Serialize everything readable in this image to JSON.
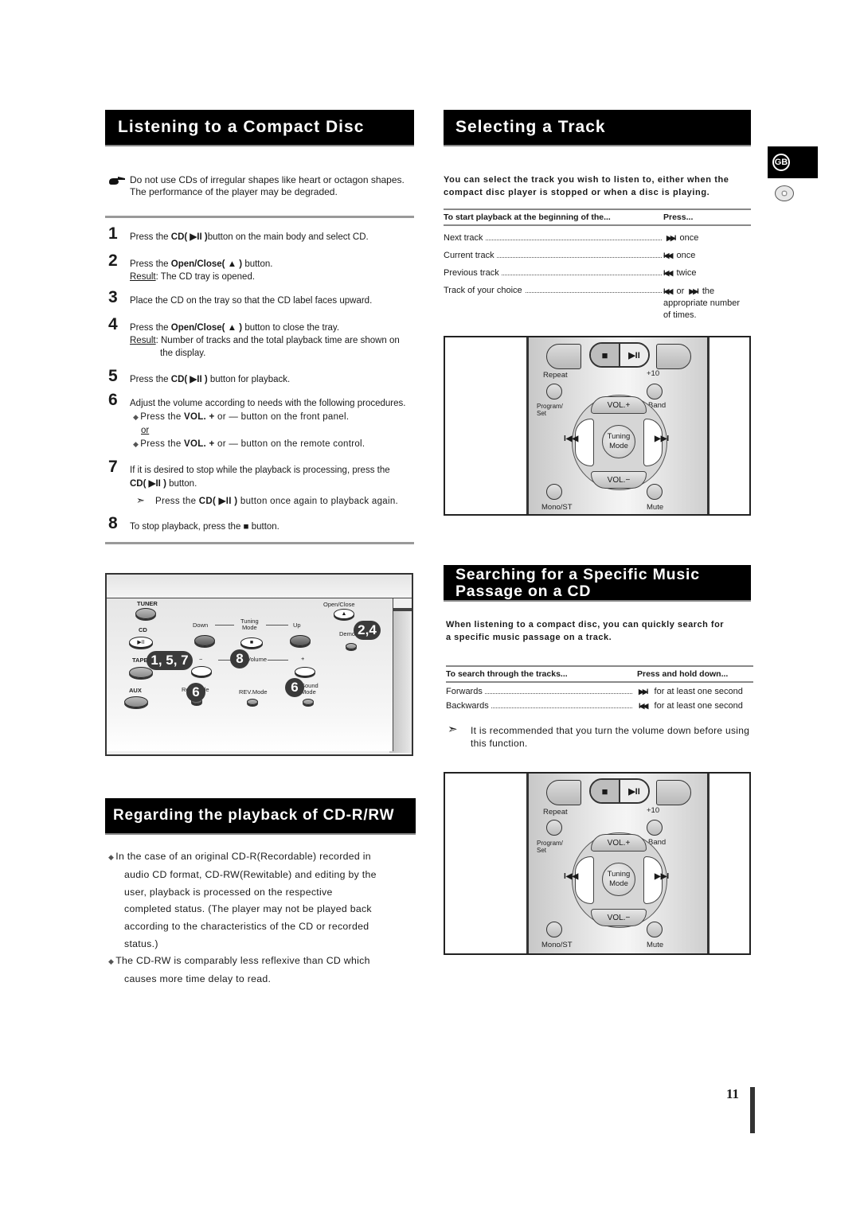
{
  "page": {
    "number": "11",
    "language_badge": "GB",
    "side_icons": [
      "gb-badge",
      "disc-icon"
    ]
  },
  "listening": {
    "title": "Listening to a Compact Disc",
    "note": {
      "icon": "pointing-hand-icon",
      "line1": "Do not use CDs of irregular shapes like heart or octagon shapes.",
      "line2": "The performance of the player may be degraded."
    },
    "steps": [
      {
        "num": "1",
        "text_pre": "Press the ",
        "bold": "CD( ▶II )",
        "text_post": "button on the main body and select CD."
      },
      {
        "num": "2",
        "text_pre": "Press the ",
        "bold": "Open/Close( ▲ )",
        "text_post": " button.",
        "result_label": "Result",
        "result": ": The CD tray is opened."
      },
      {
        "num": "3",
        "text": "Place the CD on the tray so that the CD label faces upward."
      },
      {
        "num": "4",
        "text_pre": "Press the ",
        "bold": "Open/Close( ▲ )",
        "text_post": " button to close the tray.",
        "result_label": "Result",
        "result": ": Number of tracks and the total playback time are shown on",
        "result_cont": "the display."
      },
      {
        "num": "5",
        "text_pre": "Press the ",
        "bold": "CD( ▶II )",
        "text_post": " button for playback."
      },
      {
        "num": "6",
        "text": "Adjust the volume according to needs with the following procedures.",
        "sub1_pre": "Press the ",
        "sub1_bold": "VOL. +",
        "sub1_post": " or — button on the front panel.",
        "or": "or",
        "sub2_pre": "Press the ",
        "sub2_bold": "VOL. +",
        "sub2_post": " or — button on the remote control."
      },
      {
        "num": "7",
        "text": "If it is desired to stop while the playback is processing, press the",
        "line2_bold": "CD( ▶II )",
        "line2_post": " button.",
        "tip_pre": "Press the ",
        "tip_bold": "CD( ▶II )",
        "tip_post": " button once again to playback again."
      },
      {
        "num": "8",
        "text_pre": "To stop playback, press the ",
        "symbol": "■",
        "text_post": " button."
      }
    ]
  },
  "device": {
    "labels": {
      "tuner": "TUNER",
      "band": "Band",
      "cd": "CD",
      "tape": "TAPE",
      "aux": "AUX",
      "down": "Down",
      "tuning_mode": "Tuning\nMode",
      "up": "Up",
      "open_close": "Open/Close",
      "demo": "Demo",
      "volume": "Volume",
      "minus": "−",
      "plus": "+",
      "rep_mode": "Rep.Mode",
      "rev_mode": "REV.Mode",
      "sound_mode": "Sound\nMode"
    },
    "callouts": [
      "1, 5, 7",
      "8",
      "2,4",
      "6",
      "6"
    ]
  },
  "regarding": {
    "title": "Regarding the playback of CD-R/RW",
    "bullets": [
      {
        "lines": [
          "In the case of an original CD-R(Recordable) recorded in",
          "audio CD format, CD-RW(Rewitable) and editing by the",
          "user, playback is processed on the respective",
          "completed status. (The player may not be played back",
          "according to the characteristics of the CD or recorded",
          "status.)"
        ]
      },
      {
        "lines": [
          "The CD-RW is comparably less reflexive than CD which",
          "causes more time delay to read."
        ]
      }
    ]
  },
  "selecting": {
    "title": "Selecting a Track",
    "intro_line1": "You can select the track you wish to listen to, either when the",
    "intro_line2": "compact disc player is stopped or when a disc is playing.",
    "table": {
      "headers": [
        "To start playback at the beginning of the...",
        "Press..."
      ],
      "rows": [
        {
          "label": "Next track",
          "symbol": "▶▶I",
          "value": "once"
        },
        {
          "label": "Current track",
          "symbol": "I◀◀",
          "value": "once"
        },
        {
          "label": "Previous track",
          "symbol": "I◀◀",
          "value": "twice"
        },
        {
          "label": "Track of your choice",
          "symbol": "I◀◀",
          "or": "or",
          "symbol2": "▶▶I",
          "value": "the",
          "value_cont1": "appropriate number",
          "value_cont2": "of times."
        }
      ]
    }
  },
  "remote": {
    "stop": "■",
    "play_pause": "▶II",
    "repeat": "Repeat",
    "plus10": "+10",
    "program_set": "Program/\nSet",
    "band": "Band",
    "vol_plus": "VOL.+",
    "vol_minus": "VOL.−",
    "tuning_mode": "Tuning\nMode",
    "prev": "I◀◀",
    "next": "▶▶I",
    "mono_st": "Mono/ST",
    "mute": "Mute"
  },
  "searching": {
    "title_line1": "Searching for a Specific Music",
    "title_line2": "Passage on a CD",
    "intro_line1": "When listening to a compact disc, you can quickly search for",
    "intro_line2": "a specific music passage on a track.",
    "table": {
      "headers": [
        "To search through the tracks...",
        "Press and hold down..."
      ],
      "rows": [
        {
          "label": "Forwards",
          "symbol": "▶▶I",
          "value": "for at least one second"
        },
        {
          "label": "Backwards",
          "symbol": "I◀◀",
          "value": "for at least one second"
        }
      ]
    },
    "tip_line1": "It is recommended that you turn the volume down before using",
    "tip_line2": "this function."
  }
}
